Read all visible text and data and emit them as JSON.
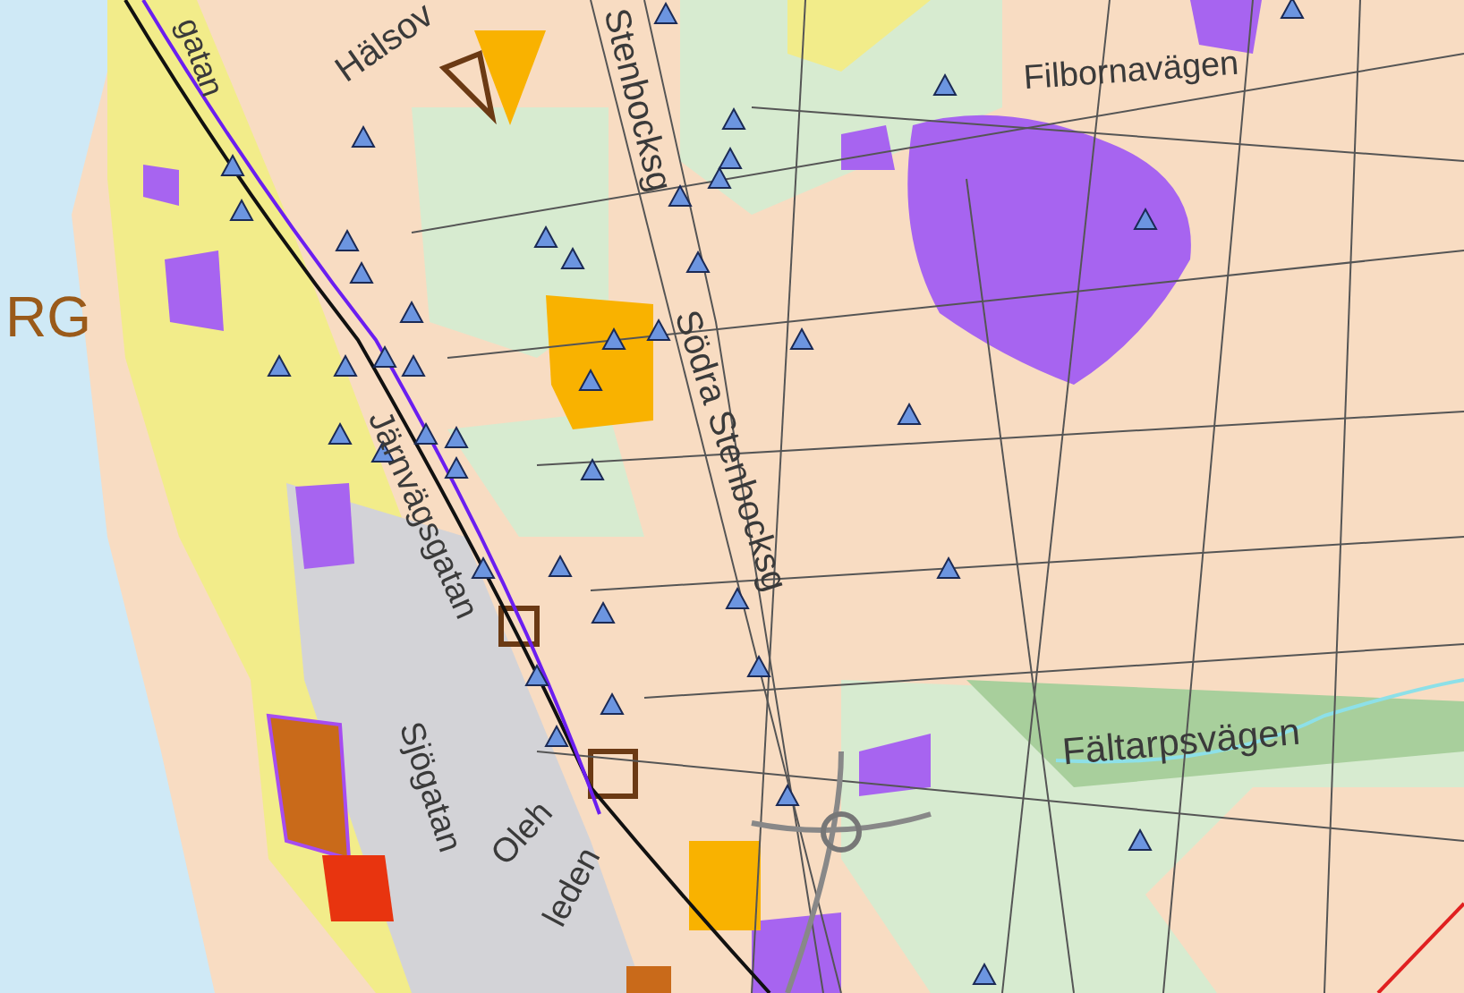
{
  "map": {
    "labels": [
      {
        "text": "gatan",
        "kind": "street"
      },
      {
        "text": "Hälsov",
        "kind": "street"
      },
      {
        "text": "Stenbocksg",
        "kind": "street"
      },
      {
        "text": "Södra Stenbocksg",
        "kind": "street"
      },
      {
        "text": "Filbornavägen",
        "kind": "street"
      },
      {
        "text": "Järnvägsgatan",
        "kind": "street"
      },
      {
        "text": "Sjögatan",
        "kind": "street"
      },
      {
        "text": "Oleh",
        "kind": "street"
      },
      {
        "text": "leden",
        "kind": "street"
      },
      {
        "text": "Fältarpsvägen",
        "kind": "street"
      },
      {
        "text": "RG",
        "kind": "place"
      }
    ]
  }
}
